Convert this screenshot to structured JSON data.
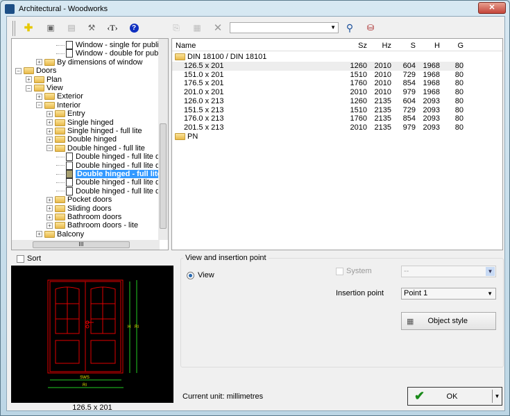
{
  "window": {
    "title": "Architectural - Woodworks",
    "close": "✕"
  },
  "toolbar": {
    "search_value": "",
    "icons": [
      "add-icon",
      "insert-icon",
      "properties-icon",
      "tools-icon",
      "text-icon",
      "help-icon",
      "copy-icon",
      "edit-icon",
      "delete-icon",
      "search-icon",
      "find-icon"
    ]
  },
  "tree": {
    "items": [
      {
        "label": "Window - single for public building co",
        "type": "doc",
        "level": 4
      },
      {
        "label": "Window - double for public building c",
        "type": "doc",
        "level": 4
      },
      {
        "label": "By dimensions of window",
        "type": "folder",
        "level": 2,
        "exp": "+"
      },
      {
        "label": "Doors",
        "type": "folder",
        "level": 0,
        "exp": "−"
      },
      {
        "label": "Plan",
        "type": "folder",
        "level": 1,
        "exp": "+"
      },
      {
        "label": "View",
        "type": "folder",
        "level": 1,
        "exp": "−"
      },
      {
        "label": "Exterior",
        "type": "folder",
        "level": 2,
        "exp": "+"
      },
      {
        "label": "Interior",
        "type": "folder",
        "level": 2,
        "exp": "−"
      },
      {
        "label": "Entry",
        "type": "folder",
        "level": 3,
        "exp": "+"
      },
      {
        "label": "Single hinged",
        "type": "folder",
        "level": 3,
        "exp": "+"
      },
      {
        "label": "Single hinged - full lite",
        "type": "folder",
        "level": 3,
        "exp": "+"
      },
      {
        "label": "Double hinged",
        "type": "folder",
        "level": 3,
        "exp": "+"
      },
      {
        "label": "Double hinged - full lite",
        "type": "folder",
        "level": 3,
        "exp": "−"
      },
      {
        "label": "Double hinged - full lite doors Typ",
        "type": "doc",
        "level": 4
      },
      {
        "label": "Double hinged - full lite doors Typ",
        "type": "doc",
        "level": 4
      },
      {
        "label": "Double hinged - full lite door",
        "type": "doc",
        "level": 4,
        "selected": true
      },
      {
        "label": "Double hinged - full lite doors Typ",
        "type": "doc",
        "level": 4
      },
      {
        "label": "Double hinged - full lite doors Typ",
        "type": "doc",
        "level": 4
      },
      {
        "label": "Pocket doors",
        "type": "folder",
        "level": 3,
        "exp": "+"
      },
      {
        "label": "Sliding doors",
        "type": "folder",
        "level": 3,
        "exp": "+"
      },
      {
        "label": "Bathroom doors",
        "type": "folder",
        "level": 3,
        "exp": "+"
      },
      {
        "label": "Bathroom doors - lite",
        "type": "folder",
        "level": 3,
        "exp": "+"
      },
      {
        "label": "Balcony",
        "type": "folder",
        "level": 2,
        "exp": "+"
      }
    ],
    "hscroll_grip": "III"
  },
  "list": {
    "columns": [
      "Name",
      "Sz",
      "Hz",
      "S",
      "H",
      "G"
    ],
    "group1": "DIN 18100 / DIN 18101",
    "rows": [
      [
        "126.5 x 201",
        "1260",
        "2010",
        "604",
        "1968",
        "80"
      ],
      [
        "151.0 x 201",
        "1510",
        "2010",
        "729",
        "1968",
        "80"
      ],
      [
        "176.5 x 201",
        "1760",
        "2010",
        "854",
        "1968",
        "80"
      ],
      [
        "201.0 x 201",
        "2010",
        "2010",
        "979",
        "1968",
        "80"
      ],
      [
        "126.0 x 213",
        "1260",
        "2135",
        "604",
        "2093",
        "80"
      ],
      [
        "151.5 x 213",
        "1510",
        "2135",
        "729",
        "2093",
        "80"
      ],
      [
        "176.0 x 213",
        "1760",
        "2135",
        "854",
        "2093",
        "80"
      ],
      [
        "201.5 x 213",
        "2010",
        "2135",
        "979",
        "2093",
        "80"
      ]
    ],
    "group2": "PN"
  },
  "sort_label": "Sort",
  "preview": {
    "caption": "126.5 x 201",
    "dim_w": "SWS",
    "dim_w2": "RI",
    "dim_h": "H",
    "dim_h2": "RI"
  },
  "options": {
    "group_label": "View and insertion point",
    "view_label": "View",
    "system_label": "System",
    "system_value": "--",
    "insertion_label": "Insertion point",
    "insertion_value": "Point 1",
    "object_style": "Object style"
  },
  "unit_text": "Current unit: millimetres",
  "ok_label": "OK",
  "colors": {
    "selection": "#3399ff",
    "drawing_red": "#e00000",
    "drawing_green": "#22cc22"
  }
}
